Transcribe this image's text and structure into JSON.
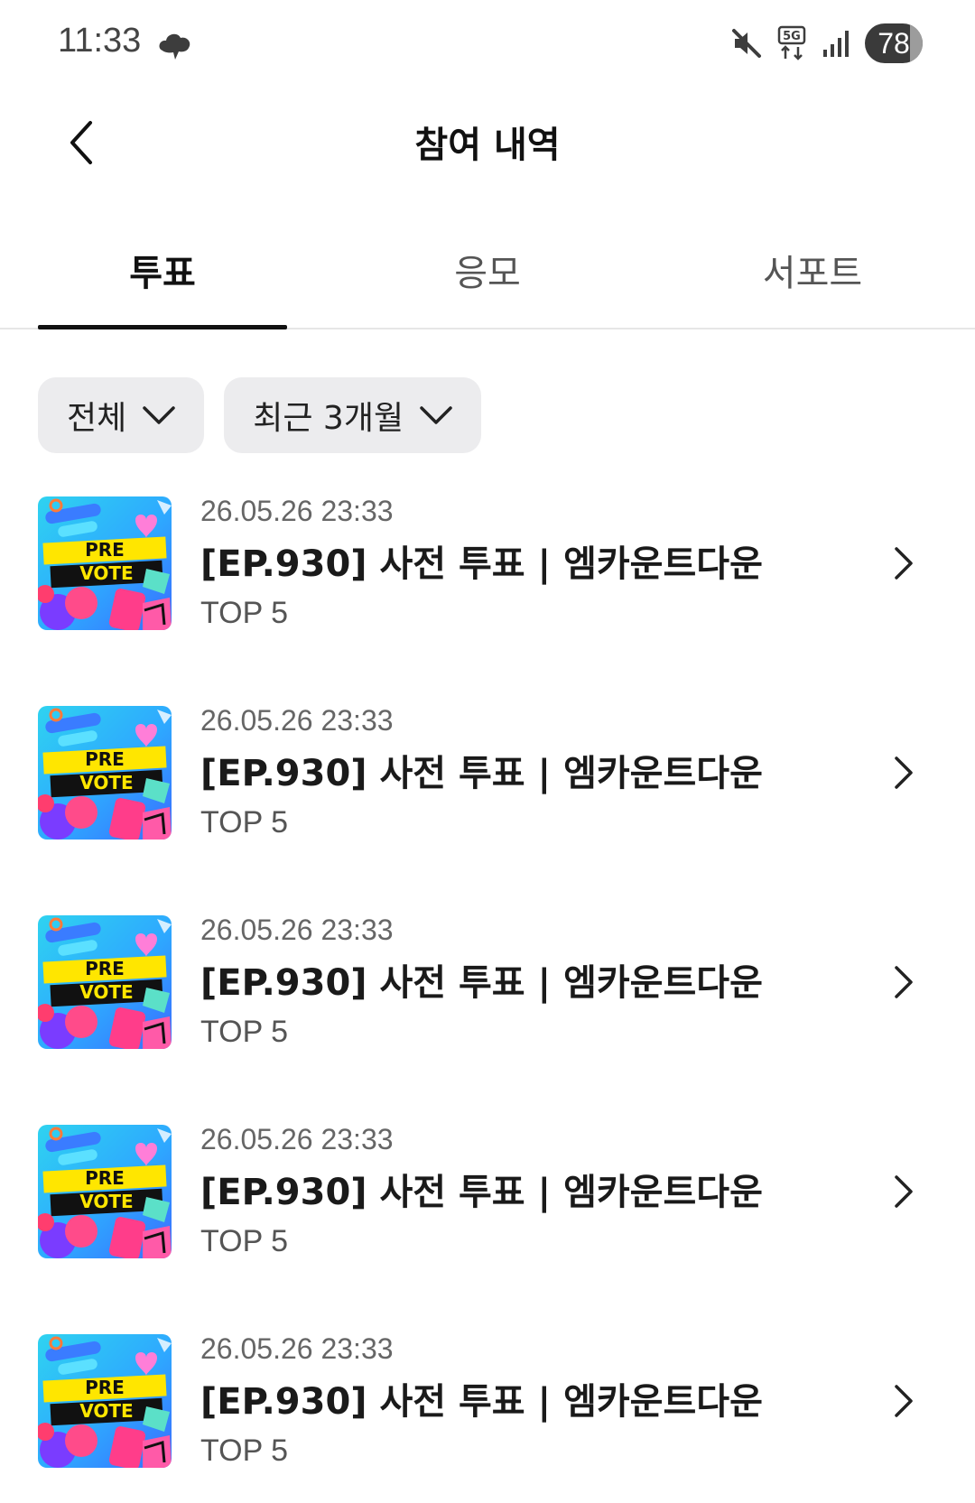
{
  "status_bar": {
    "time": "11:33",
    "battery": "78",
    "battery_level": 0.78,
    "icons": [
      "cloud-icon",
      "mute-icon",
      "5g-icon",
      "signal-icon",
      "battery-icon"
    ]
  },
  "header": {
    "title": "참여 내역",
    "back_icon": "chevron-left-icon"
  },
  "tabs": [
    {
      "label": "투표",
      "active": true
    },
    {
      "label": "응모",
      "active": false
    },
    {
      "label": "서포트",
      "active": false
    }
  ],
  "filters": [
    {
      "label": "전체",
      "icon": "chevron-down-icon"
    },
    {
      "label": "최근 3개월",
      "icon": "chevron-down-icon"
    }
  ],
  "thumbnail": {
    "line1": "PRE",
    "line2": "VOTE"
  },
  "items": [
    {
      "date": "26.05.26 23:33",
      "title": "[EP.930] 사전 투표 | 엠카운트다운",
      "sub": "TOP 5"
    },
    {
      "date": "26.05.26 23:33",
      "title": "[EP.930] 사전 투표 | 엠카운트다운",
      "sub": "TOP 5"
    },
    {
      "date": "26.05.26 23:33",
      "title": "[EP.930] 사전 투표 | 엠카운트다운",
      "sub": "TOP 5"
    },
    {
      "date": "26.05.26 23:33",
      "title": "[EP.930] 사전 투표 | 엠카운트다운",
      "sub": "TOP 5"
    },
    {
      "date": "26.05.26 23:33",
      "title": "[EP.930] 사전 투표 | 엠카운트다운",
      "sub": "TOP 5"
    }
  ],
  "colors": {
    "tab_indicator": "#111111",
    "chip_bg": "#ececee",
    "divider": "#e6e6e6"
  }
}
